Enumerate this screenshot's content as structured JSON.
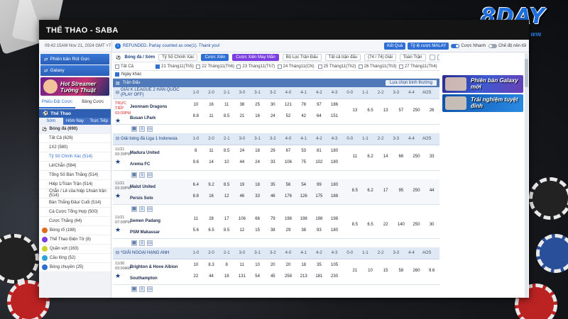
{
  "window_title": "THỂ THAO - SABA",
  "brand": {
    "name": "8DAY",
    "tagline": "START A DAY TO WIN"
  },
  "topbar": {
    "time": "09:42:15AM Nov 21, 2024 GMT +7",
    "announcement": "REFUNDED. Parlay counted as one(1). Thank you!",
    "result_button": "Kết Quả",
    "odds_type": "Tỷ lệ cược MALAY",
    "quick_bet": "Cược Nhanh",
    "oddsup_mode": "Chế độ nền tối"
  },
  "sidebar": {
    "buttons": [
      "Phiên bản Rút Gọn",
      "Galaxy"
    ],
    "banner_text": "Hot Streamer Tướng Thuật",
    "tabs": [
      "Phiếu Đặt Cược",
      "Bảng Cược"
    ],
    "sport_title": "Thể Thao",
    "sub_tabs": [
      "Sớm",
      "Hôm Nay",
      "Trực Tiếp"
    ],
    "items": [
      {
        "label": "Bóng đá (690)",
        "type": "parent"
      },
      {
        "label": "Tất Cả (626)",
        "type": "child"
      },
      {
        "label": "1X2 (580)",
        "type": "child"
      },
      {
        "label": "Tỷ Số Chính Xác (514)",
        "type": "child sel"
      },
      {
        "label": "Lẻ/Chẵn (584)",
        "type": "child"
      },
      {
        "label": "Tổng Số Bàn Thắng (514)",
        "type": "child"
      },
      {
        "label": "Hiệp 1/Toàn Trận (514)",
        "type": "child"
      },
      {
        "label": "Chẵn / Lẻ của hiệp 1/toàn trận (514)",
        "type": "child"
      },
      {
        "label": "Bàn Thắng Đầu/ Cuối (514)",
        "type": "child"
      },
      {
        "label": "Cá Cược Tổng Hợp (500)",
        "type": "child"
      },
      {
        "label": "Cược Thắng (64)",
        "type": "child"
      },
      {
        "label": "Bóng rổ (198)",
        "type": "sport",
        "color": "#e06a1d"
      },
      {
        "label": "Thể Thao Điện Tử (8)",
        "type": "sport",
        "color": "#7b3ee0"
      },
      {
        "label": "Quần vợt (163)",
        "type": "sport",
        "color": "#c8d42a"
      },
      {
        "label": "Cầu lông (52)",
        "type": "sport",
        "color": "#2fa3d4"
      },
      {
        "label": "Bóng chuyền (25)",
        "type": "sport",
        "color": "#2f6fd4"
      }
    ]
  },
  "main": {
    "nav_title": "Bóng đá / Sớm",
    "nav_items": [
      "Tỷ Số Chính Xác",
      "Cược Xiên",
      "Cược Xiên May Mắn",
      "Bộ Lọc Trận Đấu",
      "Tất cả trận đấu",
      "(74 / 74) Giải",
      "Toàn Trận"
    ],
    "dates": [
      {
        "label": "Tất Cả",
        "on": false
      },
      {
        "label": "21 Tháng11(Th5)",
        "on": true
      },
      {
        "label": "22 Tháng11(Th6)",
        "on": false
      },
      {
        "label": "23 Tháng11(Th7)",
        "on": false
      },
      {
        "label": "24 Tháng11(CN)",
        "on": false
      },
      {
        "label": "25 Tháng11(Th2)",
        "on": false
      },
      {
        "label": "26 Tháng11(Th3)",
        "on": false
      },
      {
        "label": "27 Tháng11(Th4)",
        "on": false
      }
    ],
    "special_day": "Ngày khác",
    "filterbar_label": "Trận Đấu",
    "filterbar_sort": "Lựa chọn bình thường",
    "score_cols": [
      "1-0",
      "2-0",
      "2-1",
      "3-0",
      "3-1",
      "3-2",
      "4-0",
      "4-1",
      "4-2",
      "4-3",
      "0-0",
      "1-1",
      "2-2",
      "3-3",
      "4-4",
      "AOS"
    ],
    "leagues": [
      {
        "name": "GIẢI K LEAGUE 2 HÀN QUỐC (PLAY OFF)",
        "cols": [
          "1-0",
          "2-0",
          "2-1",
          "3-0",
          "3-1",
          "3-2",
          "4-0",
          "4-1",
          "4-2",
          "4-3",
          "0-0",
          "1-1",
          "2-2",
          "3-3",
          "4-4",
          "AOS"
        ],
        "matches": [
          {
            "time": "TRỰC TIẾP\n03:00PM",
            "live": true,
            "home": "Jeonnam Dragons",
            "away": "Busan I.Park",
            "home_odds": [
              "10",
              "16",
              "11",
              "38",
              "25",
              "30",
              "121",
              "78",
              "97",
              "186"
            ],
            "away_odds": [
              "8.8",
              "11",
              "8.5",
              "21",
              "16",
              "24",
              "52",
              "42",
              "64",
              "151"
            ],
            "draw_odds": [
              "13",
              "6.5",
              "13",
              "57",
              "250",
              "26"
            ]
          }
        ]
      },
      {
        "name": "Giải bóng đá Liga 1 Indonesia",
        "cols": [
          "1-0",
          "2-0",
          "2-1",
          "3-0",
          "3-1",
          "3-2",
          "4-0",
          "4-1",
          "4-2",
          "4-3",
          "0-0",
          "1-1",
          "2-2",
          "3-3",
          "4-4",
          "AOS"
        ],
        "matches": [
          {
            "time": "11/21\n03:30PM",
            "live": false,
            "home": "Madura United",
            "away": "Arema FC",
            "home_odds": [
              "8",
              "11",
              "8.5",
              "24",
              "18",
              "29",
              "67",
              "53",
              "81",
              "180"
            ],
            "away_odds": [
              "9.6",
              "14",
              "10",
              "44",
              "24",
              "33",
              "106",
              "75",
              "102",
              "180"
            ],
            "draw_odds": [
              "11",
              "6.2",
              "14",
              "66",
              "250",
              "33"
            ]
          },
          {
            "time": "11/21\n03:30PM",
            "live": false,
            "home": "Malut United",
            "away": "Persis Solo",
            "home_odds": [
              "6.4",
              "9.2",
              "8.5",
              "19",
              "18",
              "35",
              "56",
              "54",
              "99",
              "180"
            ],
            "away_odds": [
              "8.8",
              "16",
              "12",
              "46",
              "33",
              "46",
              "176",
              "126",
              "175",
              "188"
            ],
            "draw_odds": [
              "8.5",
              "6.2",
              "17",
              "95",
              "250",
              "44"
            ]
          },
          {
            "time": "11/21\n07:00PM",
            "live": false,
            "home": "Semen Padang",
            "away": "PSM Makassar",
            "home_odds": [
              "11",
              "28",
              "17",
              "106",
              "66",
              "79",
              "198",
              "198",
              "198",
              "198"
            ],
            "away_odds": [
              "5.6",
              "6.5",
              "8.5",
              "12",
              "15",
              "38",
              "29",
              "38",
              "93",
              "180"
            ],
            "draw_odds": [
              "8.5",
              "6.5",
              "22",
              "140",
              "250",
              "30"
            ]
          }
        ]
      },
      {
        "name": "*GIẢI NGOẠI HẠNG ANH",
        "cols": [
          "1-0",
          "2-0",
          "2-1",
          "3-0",
          "3-1",
          "3-2",
          "4-0",
          "4-1",
          "4-2",
          "4-3",
          "0-0",
          "1-1",
          "2-2",
          "3-3",
          "4-4",
          "AOS"
        ],
        "matches": [
          {
            "time": "11/30\n03:00AM",
            "live": false,
            "home": "Brighton & Hove Albion",
            "away": "Southampton",
            "home_odds": [
              "10",
              "8.3",
              "8",
              "11",
              "10",
              "20",
              "20",
              "18",
              "35",
              "105"
            ],
            "away_odds": [
              "22",
              "44",
              "18",
              "131",
              "54",
              "45",
              "258",
              "213",
              "181",
              "230"
            ],
            "draw_odds": [
              "21",
              "10",
              "15",
              "58",
              "260",
              "9.6"
            ]
          }
        ]
      }
    ]
  },
  "right_panel": {
    "banner1": "Phiên bản Galaxy mới",
    "banner2": "Trải nghiệm tuyệt đỉnh"
  }
}
